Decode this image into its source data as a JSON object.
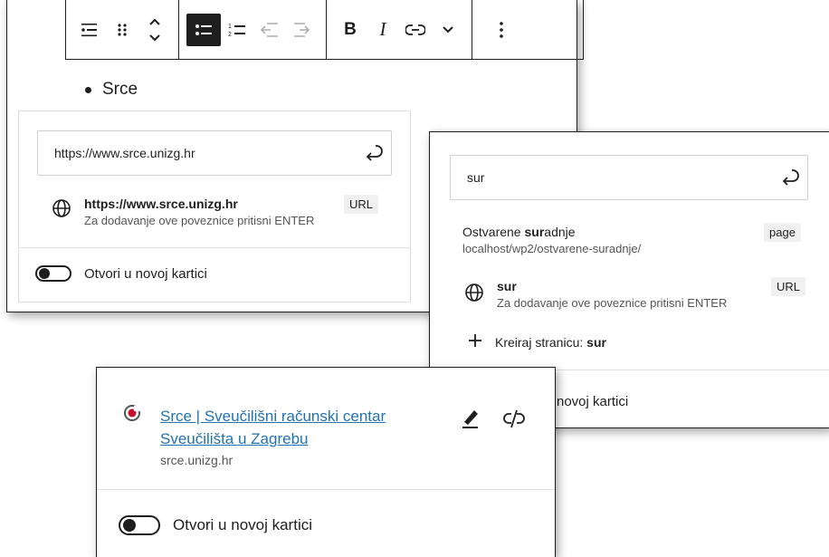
{
  "toolbar": {
    "groups": [
      [
        "list-type-icon",
        "drag-handle-icon",
        "move-up-down-icon"
      ],
      [
        "unordered-list-icon",
        "ordered-list-icon",
        "outdent-icon",
        "indent-icon"
      ],
      [
        "bold",
        "italic",
        "link-icon",
        "chevron-down-icon"
      ],
      [
        "more-options-icon"
      ]
    ],
    "bold_label": "B",
    "italic_label": "I"
  },
  "editor": {
    "list_item": "Srce"
  },
  "link_popover": {
    "input_value": "https://www.srce.unizg.hr",
    "suggestion_title": "https://www.srce.unizg.hr",
    "suggestion_hint": "Za dodavanje ove poveznice pritisni ENTER",
    "suggestion_badge": "URL",
    "toggle_label": "Otvori u novoj kartici",
    "toggle_on": false
  },
  "search_popover": {
    "input_value": "sur",
    "results": [
      {
        "title_pre": "Ostvarene ",
        "title_match": "sur",
        "title_post": "adnje",
        "url": "localhost/wp2/ostvarene-suradnje/",
        "badge": "page"
      },
      {
        "title": "sur",
        "hint": "Za dodavanje ove poveznice pritisni ENTER",
        "badge": "URL"
      }
    ],
    "create_label": "Kreiraj stranicu: ",
    "create_term": "sur",
    "toggle_label_partial": "novoj kartici"
  },
  "link_preview": {
    "title_line1": "Srce | Sveučilišni računski centar",
    "title_line2": "Sveučilišta u Zagrebu",
    "host": "srce.unizg.hr",
    "toggle_label": "Otvori u novoj kartici",
    "favicon_color": "#c8102e"
  },
  "colors": {
    "accent": "#2271b1",
    "dark": "#1e1e1e"
  }
}
